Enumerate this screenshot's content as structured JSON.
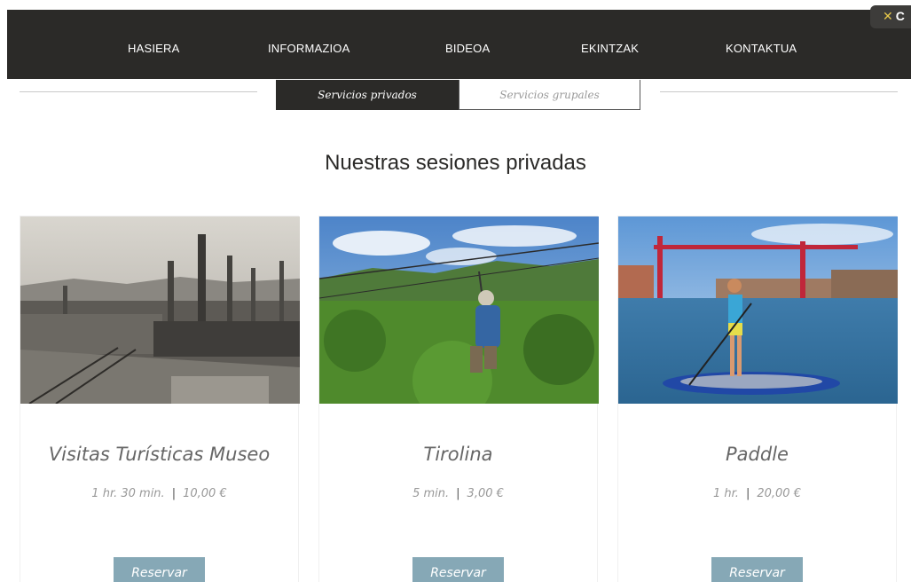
{
  "nav": {
    "items": [
      "HASIERA",
      "INFORMAZIOA",
      "BIDEOA",
      "EKINTZAK",
      "KONTAKTUA"
    ],
    "close_label": "C"
  },
  "tabs": {
    "active": "Servicios privados",
    "inactive": "Servicios grupales"
  },
  "heading": "Nuestras sesiones privadas",
  "cards": [
    {
      "title": "Visitas Turísticas Museo",
      "duration": "1 hr. 30 min.",
      "separator": "|",
      "price": "10,00 €",
      "button": "Reservar",
      "image": "factory-photo"
    },
    {
      "title": "Tirolina",
      "duration": "5 min.",
      "separator": "|",
      "price": "3,00 €",
      "button": "Reservar",
      "image": "zipline-photo"
    },
    {
      "title": "Paddle",
      "duration": "1 hr.",
      "separator": "|",
      "price": "20,00 €",
      "button": "Reservar",
      "image": "paddle-photo"
    }
  ],
  "colors": {
    "nav_bg": "#2b2a28",
    "button_bg": "#86a8b6"
  }
}
